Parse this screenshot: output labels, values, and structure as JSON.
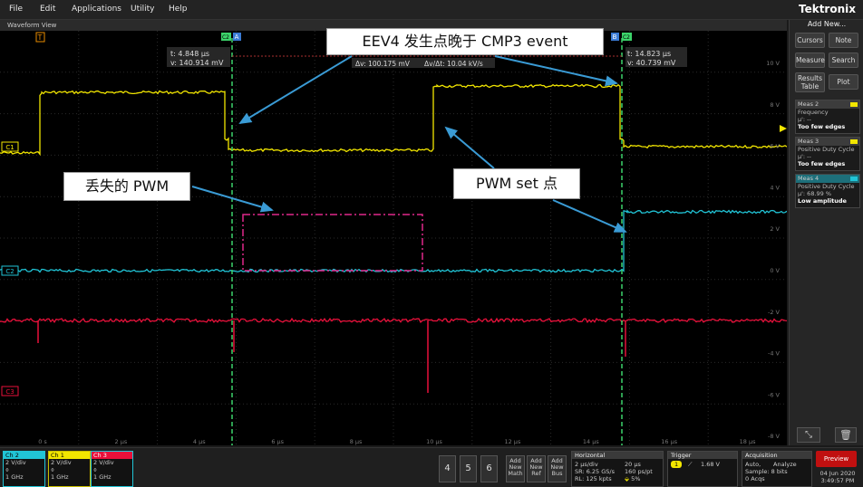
{
  "menu": [
    "File",
    "Edit",
    "Applications",
    "Utility",
    "Help"
  ],
  "brand": "Tektronix",
  "waveform_view": {
    "title": "Waveform View",
    "cursor_a": {
      "t": "t: 4.848 µs",
      "v": "v: 140.914 mV",
      "tag": "A"
    },
    "cursor_b": {
      "t": "t: 14.823 µs",
      "v": "v: 40.739 mV",
      "tag": "B"
    },
    "delta": {
      "dv": "Δv: 100.175 mV",
      "dvdt": "Δv/Δt: 10.04 kV/s"
    },
    "channel_tags": [
      "C1",
      "C2",
      "C3"
    ],
    "trigger_tag": "T",
    "right_scale": [
      "10 V",
      "8 V",
      "6 V",
      "4 V",
      "2 V",
      "0 V",
      "-2 V",
      "-4 V",
      "-6 V",
      "-8 V"
    ],
    "time_ticks": [
      "0 s",
      "2 µs",
      "4 µs",
      "6 µs",
      "8 µs",
      "10 µs",
      "12 µs",
      "14 µs",
      "16 µs",
      "18 µs"
    ],
    "c2_marker": "C2",
    "colors": {
      "ch1": "#f2e600",
      "ch2": "#21c4d6",
      "ch3": "#e8103a",
      "cursor": "#3cd36a",
      "annot_box": "#e0288a",
      "arrow": "#3a9bd5"
    }
  },
  "annotations": {
    "eev4": "EEV4 发生点晚于 CMP3 event",
    "lost_pwm": "丢失的 PWM",
    "pwm_set": "PWM set 点"
  },
  "right_panel": {
    "add_new": "Add New...",
    "buttons": [
      "Cursors",
      "Note",
      "Measure",
      "Search",
      "Results Table",
      "Plot"
    ],
    "measurements": [
      {
        "title": "Meas 2",
        "name": "Frequency",
        "mu": "µ': --",
        "status": "Too few edges",
        "color": "#f2e600"
      },
      {
        "title": "Meas 3",
        "name": "Positive Duty Cycle",
        "mu": "µ': --",
        "status": "Too few edges",
        "color": "#f2e600"
      },
      {
        "title": "Meas 4",
        "name": "Positive Duty Cycle",
        "mu": "µ': 68.99 %",
        "status": "Low amplitude",
        "color": "#21c4d6"
      }
    ]
  },
  "bottom": {
    "channels": [
      {
        "label": "Ch 2",
        "vdiv": "2 V/div",
        "bw": "1 GHz",
        "color": "#21c4d6"
      },
      {
        "label": "Ch 1",
        "vdiv": "2 V/div",
        "bw": "1 GHz",
        "color": "#f2e600"
      },
      {
        "label": "Ch 3",
        "vdiv": "2 V/div",
        "bw": "1 GHz",
        "color": "#e8103a"
      }
    ],
    "numbers": [
      "4",
      "5",
      "6"
    ],
    "add_buttons": [
      {
        "l1": "Add",
        "l2": "New",
        "l3": "Math"
      },
      {
        "l1": "Add",
        "l2": "New",
        "l3": "Ref"
      },
      {
        "l1": "Add",
        "l2": "New",
        "l3": "Bus"
      }
    ],
    "horizontal": {
      "title": "Horizontal",
      "scale": "2 µs/div",
      "sr": "SR: 6.25 GS/s",
      "rl": "RL: 125 kpts",
      "record": "20 µs",
      "pts": "160 ps/pt",
      "pct": "5%"
    },
    "trigger": {
      "title": "Trigger",
      "ch": "1",
      "level": "1.68 V"
    },
    "acquisition": {
      "title": "Acquisition",
      "mode": "Auto,",
      "analyze": "Analyze",
      "sample": "Sample: 8 bits",
      "acqs": "0 Acqs"
    },
    "preview": "Preview",
    "date": "04 Jun 2020",
    "time": "3:49:57 PM"
  }
}
